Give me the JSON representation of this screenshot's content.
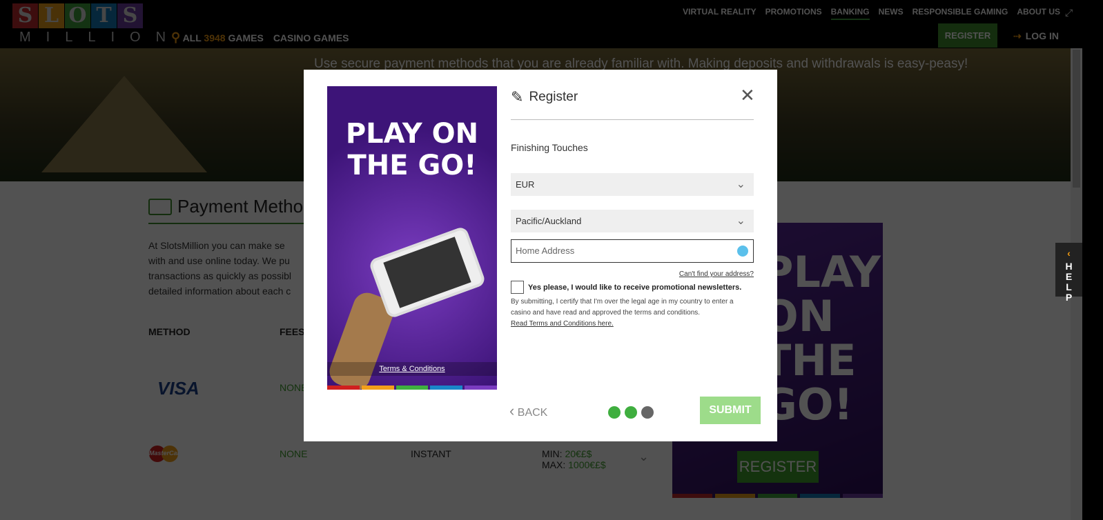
{
  "header": {
    "logo_letters": [
      "S",
      "L",
      "O",
      "T",
      "S"
    ],
    "logo_sub": "MILLION",
    "logo_colors": [
      "#c0282d",
      "#e89b1a",
      "#3e9e3a",
      "#137bb8",
      "#6a3a9e"
    ],
    "games_all": "ALL",
    "games_count": "3948",
    "games_label": "GAMES",
    "casino_games": "CASINO GAMES",
    "nav": [
      "VIRTUAL REALITY",
      "PROMOTIONS",
      "BANKING",
      "NEWS",
      "RESPONSIBLE GAMING",
      "ABOUT US"
    ],
    "active_nav": "BANKING",
    "register": "REGISTER",
    "login": "LOG IN"
  },
  "hero": {
    "text": "Use secure payment methods that you are already familiar with. Making deposits and withdrawals is easy-peasy!"
  },
  "page": {
    "title": "Payment Methods",
    "intro": [
      "At SlotsMillion you can make se",
      "with and use online today. We pu",
      "transactions as quickly as possibl",
      "detailed information about each c"
    ],
    "columns": {
      "method": "METHOD",
      "fees": "FEES"
    },
    "rows": [
      {
        "method": "VISA",
        "fees": "NONE"
      },
      {
        "method": "MasterCard",
        "fees": "NONE",
        "time": "INSTANT",
        "min_label": "MIN:",
        "min": "20€£$",
        "max_label": "MAX:",
        "max": "1000€£$"
      }
    ]
  },
  "ad": {
    "title": "PLAY ON THE GO!",
    "register": "REGISTER"
  },
  "help": {
    "label": "HELP"
  },
  "modal": {
    "promo_title": "PLAY ON THE GO!",
    "promo_terms": "Terms & Conditions",
    "title": "Register",
    "subtitle": "Finishing Touches",
    "currency": "EUR",
    "timezone": "Pacific/Auckland",
    "address_placeholder": "Home Address",
    "cant_find": "Can't find your address?",
    "newsletter": "Yes please, I would like to receive promotional newsletters.",
    "newsletter_checked": false,
    "legal": "By submitting, I certify that I'm over the legal age in my country to enter a casino and have read and approved the terms and conditions.",
    "terms_link": "Read Terms and Conditions here.",
    "back": "BACK",
    "submit": "SUBMIT",
    "steps_total": 3,
    "steps_done": 2,
    "step_colors": {
      "done": "#3fae3f",
      "todo": "#666666"
    }
  }
}
